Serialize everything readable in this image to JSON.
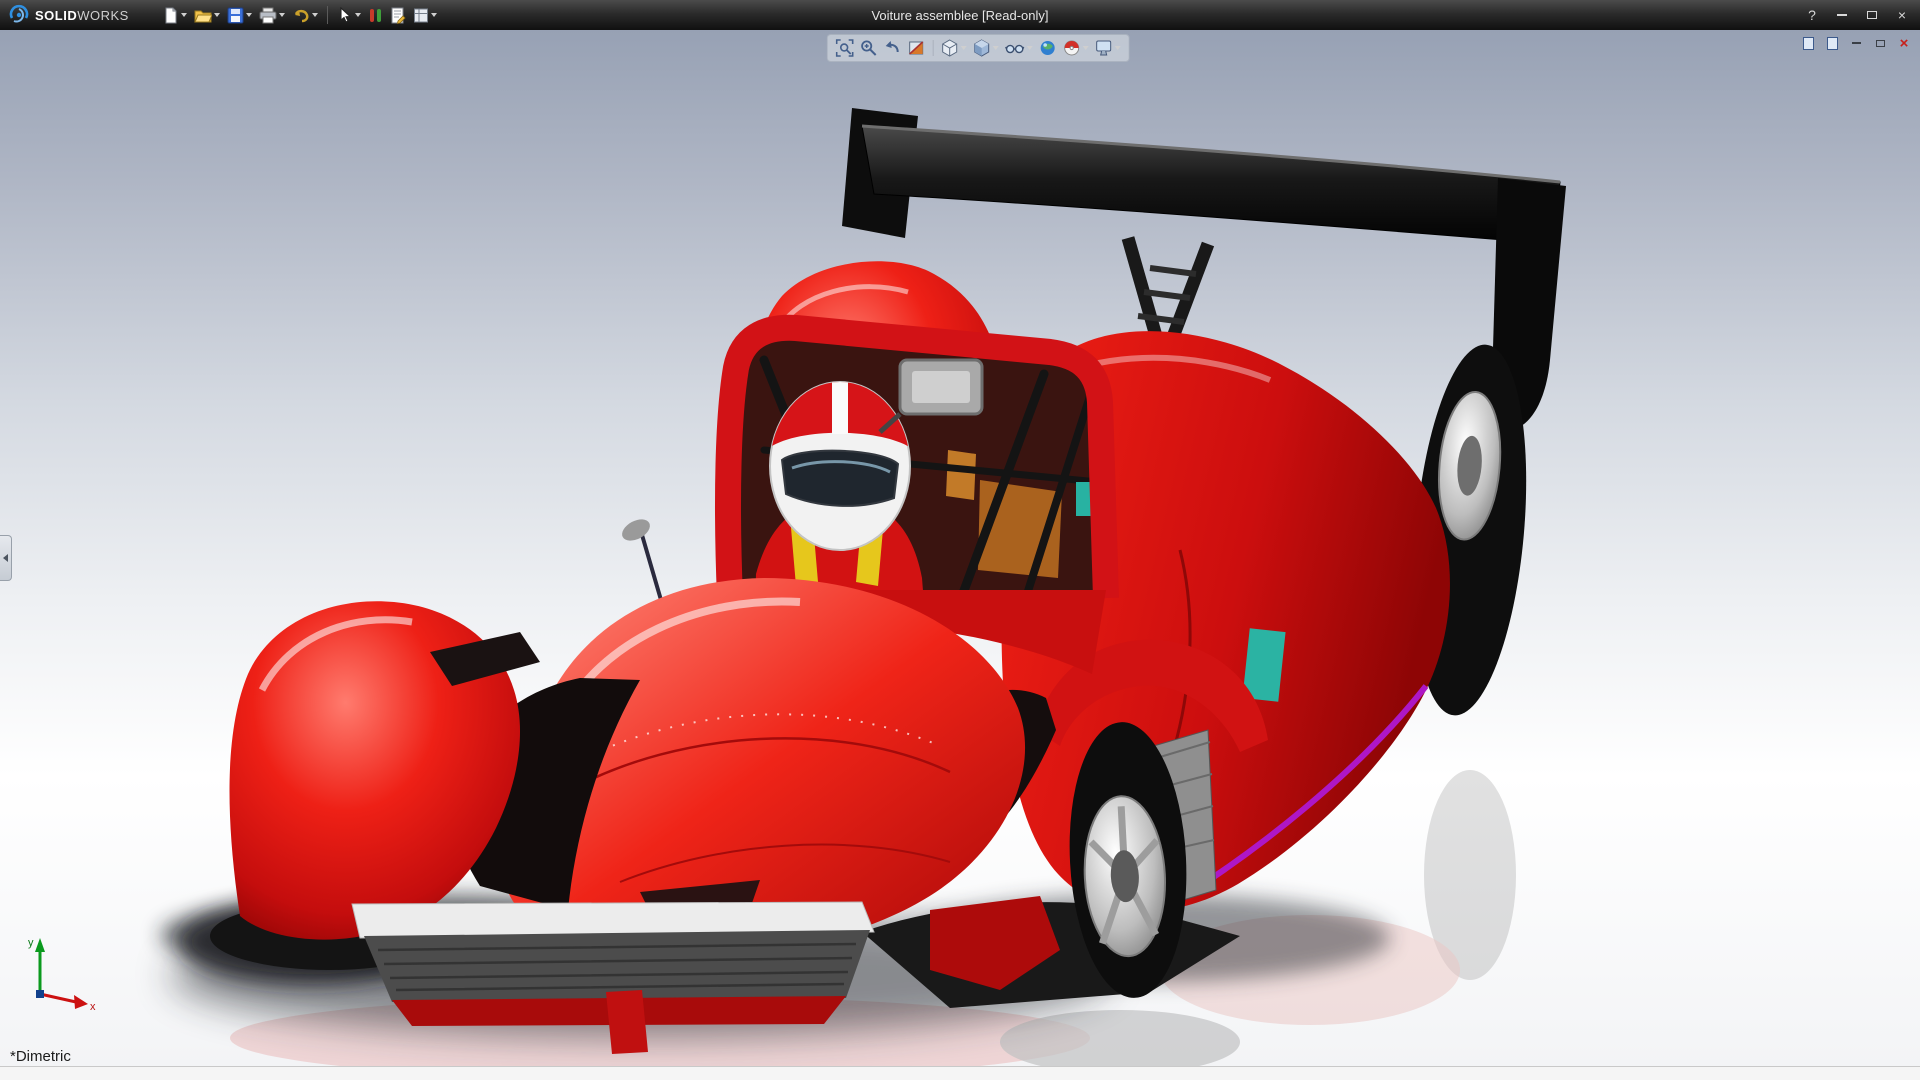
{
  "window": {
    "title": "Voiture assemblee [Read-only]",
    "brand": {
      "logo": "dassault-swirl-icon",
      "solid": "SOLID",
      "works": "WORKS"
    },
    "controls": {
      "help": "?",
      "close": "×"
    }
  },
  "toolbars": {
    "standard": [
      {
        "name": "new-document",
        "dropdown": true
      },
      {
        "name": "open-document",
        "dropdown": true
      },
      {
        "name": "save",
        "dropdown": true
      },
      {
        "name": "print",
        "dropdown": true
      },
      {
        "name": "undo",
        "dropdown": true
      },
      {
        "name": "select",
        "dropdown": true
      },
      {
        "name": "selection-filter",
        "dropdown": false
      },
      {
        "name": "document-properties",
        "dropdown": false
      },
      {
        "name": "options",
        "dropdown": true
      }
    ],
    "heads_up": [
      {
        "name": "zoom-to-fit",
        "dropdown": false
      },
      {
        "name": "zoom-to-area",
        "dropdown": false
      },
      {
        "name": "previous-view",
        "dropdown": false
      },
      {
        "name": "section-view",
        "dropdown": false
      },
      {
        "name": "view-orientation",
        "dropdown": true
      },
      {
        "name": "display-style",
        "dropdown": true
      },
      {
        "name": "hide-show-items",
        "dropdown": true
      },
      {
        "name": "edit-appearance",
        "dropdown": false
      },
      {
        "name": "apply-scene",
        "dropdown": true
      },
      {
        "name": "view-settings",
        "dropdown": true
      }
    ],
    "document_window": [
      {
        "name": "new-window"
      },
      {
        "name": "tile-windows"
      },
      {
        "name": "minimize-document"
      },
      {
        "name": "restore-document"
      },
      {
        "name": "close-document"
      }
    ]
  },
  "viewport": {
    "view_label": "*Dimetric",
    "triad": {
      "x": "x",
      "y": "y"
    },
    "model": {
      "kind": "assembly",
      "subject_colors_note": "red prototype race car with black rear wing"
    }
  },
  "colors": {
    "titlebar": "#2b2b2b",
    "viewport_top": "#97a1b4",
    "viewport_bottom": "#ffffff",
    "car_body": "#d61318",
    "car_body_highlight": "#ff7b6e",
    "car_body_shadow": "#870404",
    "wing_black": "#121212",
    "tire": "#0e0e0e",
    "wheel_rim": "#c9c9c9",
    "trim_magenta": "#ae17c6",
    "trim_teal": "#2bb3a3",
    "harness_yellow": "#e6c71c",
    "helmet_white": "#f2f2f2",
    "doc_close_red": "#c8201a"
  }
}
